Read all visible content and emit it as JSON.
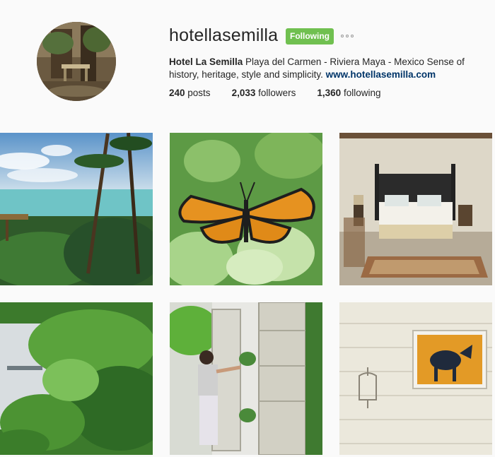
{
  "profile": {
    "username": "hotellasemilla",
    "follow_label": "Following",
    "more_icon": "ellipsis-icon",
    "bio_name": "Hotel La Semilla",
    "bio_text": " Playa del Carmen - Riviera Maya - Mexico Sense of history, heritage, style and simplicity. ",
    "website": "www.hotellasemilla.com",
    "stats": [
      {
        "value": "240",
        "label": " posts"
      },
      {
        "value": "2,033",
        "label": " followers"
      },
      {
        "value": "1,360",
        "label": " following"
      }
    ]
  },
  "colors": {
    "following_button": "#70c050",
    "link": "#003569",
    "background": "#fafafa"
  },
  "posts": [
    {
      "subject": "beach-palms-photo"
    },
    {
      "subject": "monarch-butterfly-photo"
    },
    {
      "subject": "hotel-bedroom-photo"
    },
    {
      "subject": "leaves-courtyard-photo"
    },
    {
      "subject": "woman-watering-plants-photo"
    },
    {
      "subject": "donkey-painting-photo"
    }
  ]
}
